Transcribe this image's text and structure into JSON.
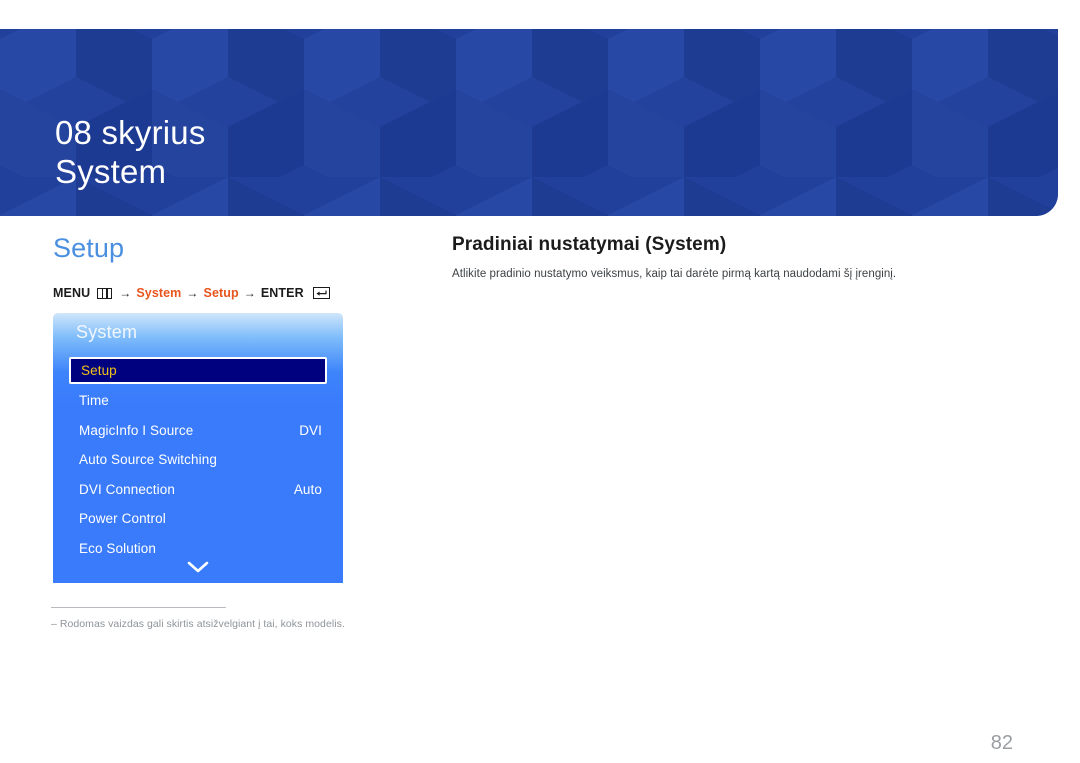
{
  "banner": {
    "chapter_label": "08 skyrius",
    "chapter_title": "System",
    "bg_color": "#22409b",
    "pattern": "isometric-cubes"
  },
  "section": {
    "heading": "Setup",
    "heading_color": "#4a8fe0"
  },
  "breadcrumb": {
    "menu_label": "MENU",
    "menu_icon": "menu-grid-icon",
    "arrow": "→",
    "path_1": "System",
    "path_2": "Setup",
    "enter_label": "ENTER",
    "enter_icon": "enter-key-icon",
    "accent_color": "#e8551f"
  },
  "osd": {
    "title": "System",
    "selected_index": 0,
    "selected_bg": "#00017e",
    "selected_text_color": "#f0c21a",
    "items": [
      {
        "label": "Setup",
        "value": "",
        "selected": true
      },
      {
        "label": "Time",
        "value": "",
        "selected": false
      },
      {
        "label": "MagicInfo I Source",
        "value": "DVI",
        "selected": false
      },
      {
        "label": "Auto Source Switching",
        "value": "",
        "selected": false
      },
      {
        "label": "DVI Connection",
        "value": "Auto",
        "selected": false
      },
      {
        "label": "Power Control",
        "value": "",
        "selected": false
      },
      {
        "label": "Eco Solution",
        "value": "",
        "selected": false
      }
    ],
    "scroll_icon": "chevron-down-icon"
  },
  "footnote": {
    "text": "– Rodomas vaizdas gali skirtis atsižvelgiant į tai, koks modelis."
  },
  "content": {
    "heading": "Pradiniai nustatymai (System)",
    "description": "Atlikite pradinio nustatymo veiksmus, kaip tai darėte pirmą kartą naudodami šį įrenginį."
  },
  "page_number": "82"
}
